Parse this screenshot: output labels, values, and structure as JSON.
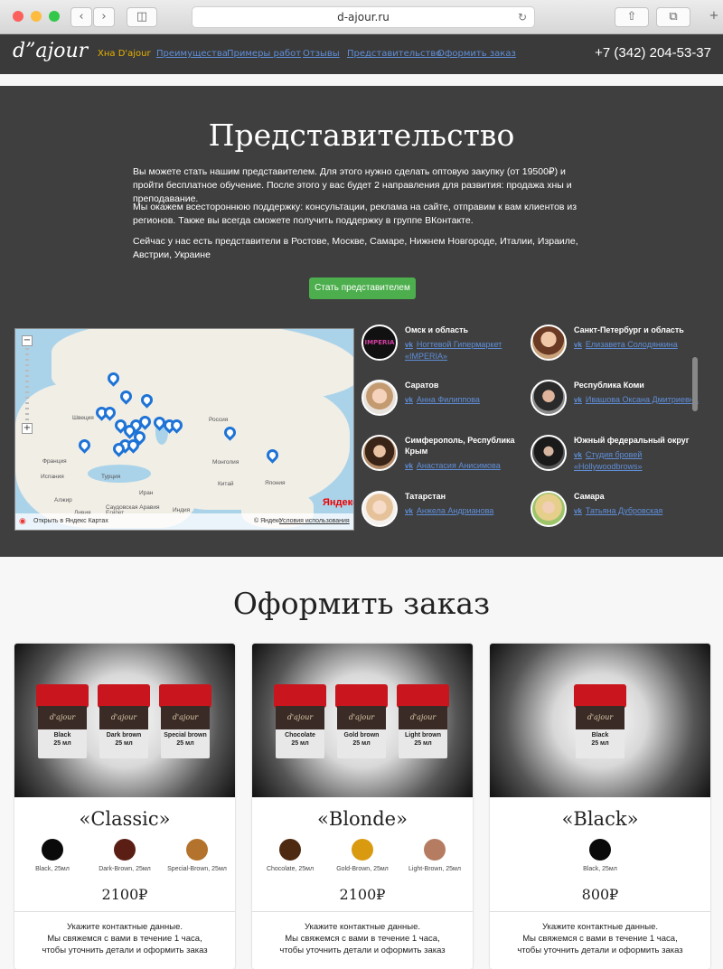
{
  "browser": {
    "url": "d-ajour.ru",
    "new_tab": "+"
  },
  "nav": {
    "logo": "d”ajour",
    "links": [
      "Хна D'ajour",
      "Преимущества",
      "Примеры работ",
      "Отзывы",
      "Представительство",
      "Оформить заказ"
    ],
    "phone": "+7 (342) 204-53-37",
    "active_color": "#e8b200",
    "link_color": "#5f8ed8"
  },
  "rep": {
    "title": "Представительство",
    "paragraphs": [
      "Вы можете стать нашим представителем. Для этого нужно сделать оптовую закупку (от 19500₽) и пройти бесплатное обучение. После этого у вас будет 2 направления для развития: продажа хны и преподавание.",
      "Мы окажем всестороннюю поддержку: консультации, реклама на сайте, отправим к вам клиентов из регионов. Также вы всегда сможете получить поддержку в группе ВКонтакте.",
      "Сейчас у нас есть представители в Ростове, Москве, Самаре, Нижнем Новгороде, Италии, Израиле, Австрии, Украине"
    ],
    "button": "Стать представителем",
    "map": {
      "labels": [
        "Швеция",
        "Франция",
        "Испания",
        "Турция",
        "Иран",
        "Саудовская Аравия",
        "Алжир",
        "Ливия",
        "Египет",
        "Россия",
        "Монголия",
        "Китай",
        "Япония",
        "Индия"
      ],
      "open_link": "Открыть в Яндекс Картах",
      "brand": "Яндекс",
      "copyright": "© Яндекс",
      "terms": "Условия использования",
      "zoom_in": "+",
      "zoom_out": "−"
    },
    "vk_icon": "vk-icon",
    "items": [
      {
        "region": "Омск и область",
        "contact": "Ногтевой Гипермаркет «IMPERIA»",
        "avatar_text": "IMPERIA"
      },
      {
        "region": "Санкт-Петербург и область",
        "contact": "Елизавета Солодянкина",
        "avatar_text": ""
      },
      {
        "region": "Саратов",
        "contact": "Анна Филиппова",
        "avatar_text": ""
      },
      {
        "region": "Республика Коми",
        "contact": "Ивашова Оксана Дмитриевна",
        "avatar_text": ""
      },
      {
        "region": "Симферополь, Республика Крым",
        "contact": "Анастасия Анисимова",
        "avatar_text": ""
      },
      {
        "region": "Южный федеральный округ",
        "contact": "Студия бровей «Hollywoodbrows»",
        "avatar_text": ""
      },
      {
        "region": "Татарстан",
        "contact": "Анжела Андрианова",
        "avatar_text": ""
      },
      {
        "region": "Самара",
        "contact": "Татьяна Дубровская",
        "avatar_text": ""
      }
    ]
  },
  "order": {
    "title": "Оформить заказ",
    "jar_brand": "d'ajour",
    "jar_volume": "25 мл",
    "info": [
      "Укажите контактные данные.",
      "Мы свяжемся с вами в течение 1 часа,",
      "чтобы уточнить детали и оформить заказ"
    ],
    "cards": [
      {
        "title": "«Classic»",
        "price": "2100₽",
        "jars": [
          "Black",
          "Dark brown",
          "Special brown"
        ],
        "swatches": [
          {
            "name": "Black, 25мл",
            "color": "#0a0a0a"
          },
          {
            "name": "Dark-Brown, 25мл",
            "color": "#5a1e14"
          },
          {
            "name": "Special-Brown, 25мл",
            "color": "#b4732c"
          }
        ]
      },
      {
        "title": "«Blonde»",
        "price": "2100₽",
        "jars": [
          "Chocolate",
          "Gold brown",
          "Light brown"
        ],
        "swatches": [
          {
            "name": "Chocolate, 25мл",
            "color": "#4f2a12"
          },
          {
            "name": "Gold-Brown, 25мл",
            "color": "#d99a10"
          },
          {
            "name": "Light-Brown, 25мл",
            "color": "#b57c62"
          }
        ]
      },
      {
        "title": "«Black»",
        "price": "800₽",
        "jars": [
          "Black"
        ],
        "swatches": [
          {
            "name": "Black, 25мл",
            "color": "#0a0a0a"
          }
        ]
      }
    ]
  }
}
